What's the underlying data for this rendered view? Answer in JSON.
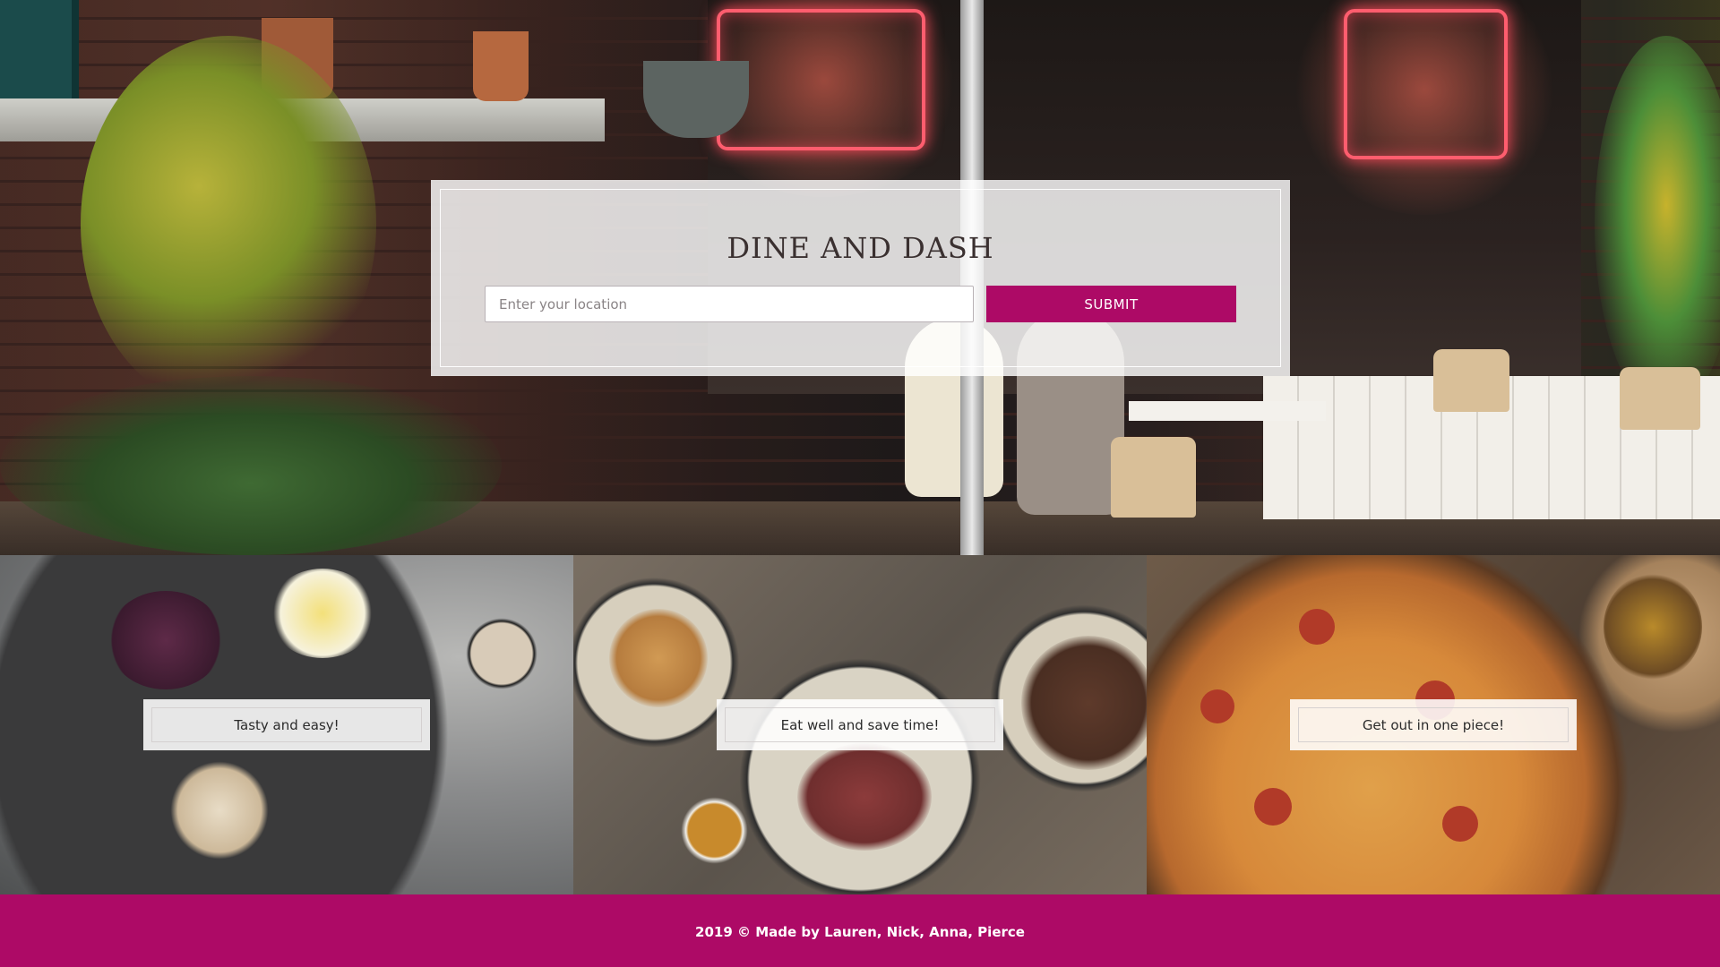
{
  "hero": {
    "title": "DINE AND DASH",
    "search": {
      "placeholder": "Enter your location",
      "value": "",
      "submit_label": "SUBMIT"
    }
  },
  "features": [
    {
      "label": "Tasty and easy!"
    },
    {
      "label": "Eat well and save time!"
    },
    {
      "label": "Get out in one piece!"
    }
  ],
  "footer": {
    "text": "2019 © Made by Lauren, Nick, Anna, Pierce"
  },
  "colors": {
    "accent": "#ad0a66",
    "card_background": "#ffffff"
  }
}
